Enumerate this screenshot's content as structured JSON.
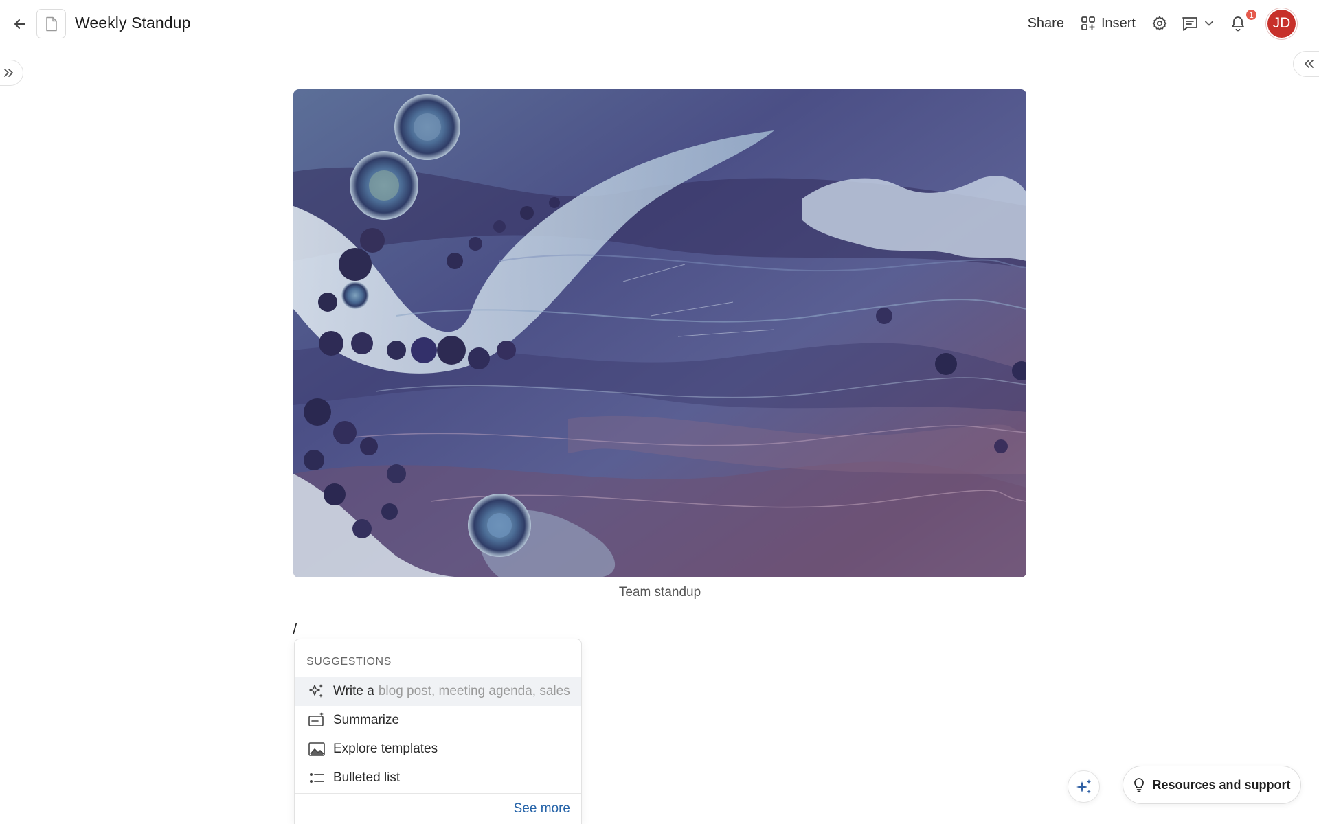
{
  "header": {
    "doc_title": "Weekly Standup",
    "share_label": "Share",
    "insert_label": "Insert",
    "notification_count": "1",
    "avatar_initials": "JD",
    "icons": [
      "back-arrow-icon",
      "document-icon",
      "grid-icon",
      "gear-icon",
      "comment-icon",
      "chevron-down-icon",
      "bell-icon"
    ]
  },
  "content": {
    "cover_caption": "Team standup",
    "typed_text": "/"
  },
  "slash_menu": {
    "heading": "SUGGESTIONS",
    "items": [
      {
        "label": "Write a",
        "hint": "blog post, meeting agenda, sales",
        "icon": "sparkles-icon",
        "active": true
      },
      {
        "label": "Summarize",
        "hint": "",
        "icon": "summarize-icon",
        "active": false
      },
      {
        "label": "Explore templates",
        "hint": "",
        "icon": "image-icon",
        "active": false
      },
      {
        "label": "Bulleted list",
        "hint": "",
        "icon": "bulleted-list-icon",
        "active": false
      }
    ],
    "see_more_label": "See more"
  },
  "footer": {
    "resources_label": "Resources and support"
  },
  "colors": {
    "avatar_bg": "#c7302a",
    "badge_bg": "#e55a4c",
    "link": "#2563a8",
    "active_row": "#f0f2f5"
  }
}
